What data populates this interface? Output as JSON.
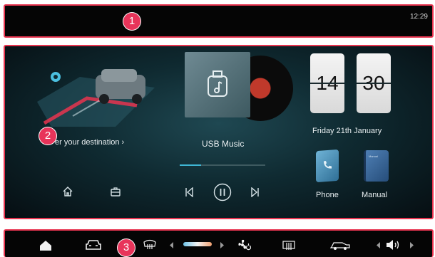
{
  "status_bar": {
    "time": "12:29"
  },
  "badges": [
    "1",
    "2",
    "3"
  ],
  "navigation": {
    "destination_text": "er your destination ›"
  },
  "media": {
    "source_label": "USB Music",
    "progress": 0.25
  },
  "datetime": {
    "hour": "14",
    "minute": "30",
    "date": "Friday 21th January"
  },
  "apps": [
    {
      "label": "Phone"
    },
    {
      "label": "Manual"
    }
  ],
  "dock": {
    "temperature_level": 0.45
  },
  "icons": [
    "home-icon",
    "briefcase-icon",
    "previous-track-icon",
    "pause-icon",
    "next-track-icon",
    "car-icon",
    "rear-defrost-icon",
    "fan-icon",
    "front-defrost-icon",
    "car-exterior-icon",
    "volume-icon"
  ],
  "colors": {
    "annotation": "#e8344f",
    "badge": "#e8345a",
    "accent": "#3fb6d4",
    "phone": "#3a7fa6",
    "manual": "#2f5a8c"
  }
}
